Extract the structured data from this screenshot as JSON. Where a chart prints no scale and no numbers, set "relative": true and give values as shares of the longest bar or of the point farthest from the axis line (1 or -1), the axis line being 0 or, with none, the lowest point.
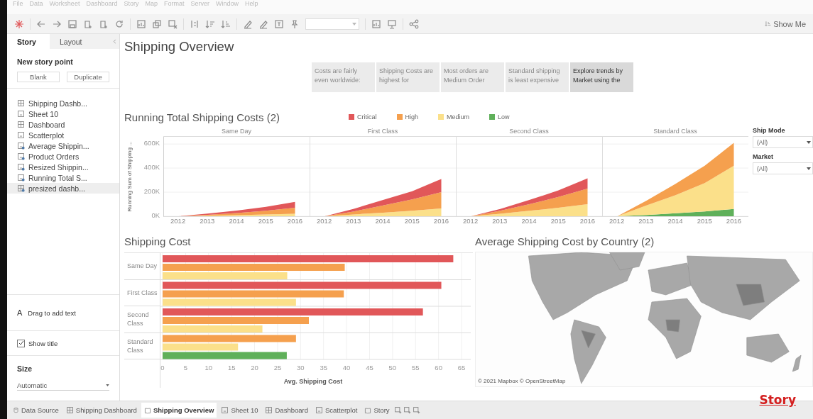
{
  "menu_bar": {
    "items": [
      "File",
      "Data",
      "Worksheet",
      "Dashboard",
      "Story",
      "Map",
      "Format",
      "Server",
      "Window",
      "Help"
    ]
  },
  "toolbar": {
    "show_me": "Show Me"
  },
  "side_panel": {
    "tabs": [
      {
        "label": "Story",
        "selected": true
      },
      {
        "label": "Layout",
        "selected": false
      }
    ],
    "new_story_point": {
      "title": "New story point",
      "buttons": [
        "Blank",
        "Duplicate"
      ]
    },
    "sheets": [
      {
        "label": "Shipping Dashb...",
        "kind": "dashboard",
        "selected": false
      },
      {
        "label": "Sheet 10",
        "kind": "sheet",
        "selected": false
      },
      {
        "label": "Dashboard",
        "kind": "dashboard",
        "selected": false
      },
      {
        "label": "Scatterplot",
        "kind": "sheet",
        "selected": false
      },
      {
        "label": "Average Shippin...",
        "kind": "linked-sheet",
        "selected": false
      },
      {
        "label": "Product Orders",
        "kind": "linked-sheet",
        "selected": false
      },
      {
        "label": "Resized Shippin...",
        "kind": "linked-sheet",
        "selected": false
      },
      {
        "label": "Running Total S...",
        "kind": "linked-sheet",
        "selected": false
      },
      {
        "label": "presized dashb...",
        "kind": "linked-dashboard",
        "selected": true
      }
    ],
    "drag_text": {
      "glyph": "A",
      "label": "Drag to add text"
    },
    "show_title": {
      "label": "Show title",
      "checked": true
    },
    "size": {
      "title": "Size",
      "value": "Automatic"
    }
  },
  "story": {
    "title": "Shipping Overview",
    "points": [
      {
        "caption": "Costs are fairly even worldwide:",
        "selected": false
      },
      {
        "caption": "Shipping Costs are highest for",
        "selected": false
      },
      {
        "caption": "Most orders are Medium Order",
        "selected": false
      },
      {
        "caption": "Standard shipping is least expensive",
        "selected": false
      },
      {
        "caption": "Explore trends by Market using the",
        "selected": true
      }
    ]
  },
  "running_total": {
    "title": "Running Total Shipping Costs (2)",
    "ylabel": "Running Sum of Shipping ...",
    "legend": [
      {
        "label": "Critical",
        "color": "#e15759"
      },
      {
        "label": "High",
        "color": "#f5a04e"
      },
      {
        "label": "Medium",
        "color": "#fbe08a"
      },
      {
        "label": "Low",
        "color": "#5fb05a"
      }
    ],
    "panels": [
      {
        "chart_data": {
          "type": "area",
          "stacked": true,
          "grid": true,
          "title": "Same Day",
          "categories": [
            "2012",
            "2013",
            "2014",
            "2015",
            "2016"
          ],
          "ylim": [
            0,
            660000
          ],
          "yticks": [
            {
              "value": 600000,
              "label": "600K"
            },
            {
              "value": 400000,
              "label": "400K"
            },
            {
              "value": 200000,
              "label": "200K"
            },
            {
              "value": 0,
              "label": "0K"
            }
          ],
          "series": [
            {
              "color": "#fbe08a",
              "values": [
                0,
                4000,
                9000,
                14000,
                20000
              ]
            },
            {
              "color": "#f5a04e",
              "values": [
                0,
                8000,
                18000,
                32000,
                50000
              ]
            },
            {
              "color": "#e15759",
              "values": [
                0,
                10000,
                20000,
                32000,
                50000
              ]
            }
          ]
        }
      },
      {
        "chart_data": {
          "type": "area",
          "stacked": true,
          "grid": true,
          "title": "First Class",
          "categories": [
            "2012",
            "2013",
            "2014",
            "2015",
            "2016"
          ],
          "relative": true,
          "ylim": [
            0,
            660000
          ],
          "series": [
            {
              "color": "#fbe08a",
              "values": [
                0,
                15000,
                30000,
                45000,
                65000
              ]
            },
            {
              "color": "#f5a04e",
              "values": [
                0,
                25000,
                60000,
                95000,
                135000
              ]
            },
            {
              "color": "#e15759",
              "values": [
                0,
                22000,
                45000,
                68000,
                110000
              ]
            }
          ]
        }
      },
      {
        "chart_data": {
          "type": "area",
          "stacked": true,
          "grid": true,
          "title": "Second Class",
          "categories": [
            "2012",
            "2013",
            "2014",
            "2015",
            "2016"
          ],
          "relative": true,
          "ylim": [
            0,
            660000
          ],
          "series": [
            {
              "color": "#fbe08a",
              "values": [
                0,
                20000,
                45000,
                70000,
                100000
              ]
            },
            {
              "color": "#f5a04e",
              "values": [
                0,
                25000,
                55000,
                90000,
                130000
              ]
            },
            {
              "color": "#e15759",
              "values": [
                0,
                15000,
                35000,
                55000,
                85000
              ]
            }
          ]
        }
      },
      {
        "chart_data": {
          "type": "area",
          "stacked": true,
          "grid": true,
          "title": "Standard Class",
          "categories": [
            "2012",
            "2013",
            "2014",
            "2015",
            "2016"
          ],
          "relative": true,
          "ylim": [
            0,
            660000
          ],
          "series": [
            {
              "color": "#5fb05a",
              "values": [
                0,
                10000,
                25000,
                40000,
                60000
              ]
            },
            {
              "color": "#fbe08a",
              "values": [
                0,
                80000,
                150000,
                235000,
                360000
              ]
            },
            {
              "color": "#f5a04e",
              "values": [
                0,
                40000,
                95000,
                145000,
                190000
              ]
            }
          ]
        }
      }
    ]
  },
  "filters": [
    {
      "title": "Ship Mode",
      "value": "(All)"
    },
    {
      "title": "Market",
      "value": "(All)"
    }
  ],
  "shipping_cost": {
    "title": "Shipping Cost",
    "chart_data": {
      "type": "bar",
      "orientation": "horizontal",
      "grid": true,
      "categories": [
        "Same Day",
        "First Class",
        "Second Class",
        "Standard Class"
      ],
      "xlabel": "Avg. Shipping Cost",
      "xlim": [
        0,
        67
      ],
      "xticks": [
        0,
        5,
        10,
        15,
        20,
        25,
        30,
        35,
        40,
        45,
        50,
        55,
        60,
        65
      ],
      "series": [
        {
          "color": "#e15759",
          "values": [
            63.2,
            60.6,
            56.6,
            null
          ]
        },
        {
          "color": "#f5a04e",
          "values": [
            39.6,
            39.4,
            31.8,
            29
          ]
        },
        {
          "color": "#fbe08a",
          "values": [
            27.1,
            29,
            21.7,
            16.4
          ]
        },
        {
          "color": "#5fb05a",
          "values": [
            null,
            null,
            null,
            27
          ]
        }
      ]
    }
  },
  "map": {
    "title": "Average Shipping Cost by Country (2)",
    "kind": "picture",
    "attribution": "© 2021 Mapbox © OpenStreetMap"
  },
  "sheet_tabs": [
    {
      "label": "Data Source",
      "kind": "datasource",
      "selected": false
    },
    {
      "label": "Shipping Dashboard",
      "kind": "dashboard",
      "selected": false
    },
    {
      "label": "Shipping Overview",
      "kind": "story",
      "selected": true
    },
    {
      "label": "Sheet 10",
      "kind": "sheet",
      "selected": false
    },
    {
      "label": "Dashboard",
      "kind": "dashboard",
      "selected": false
    },
    {
      "label": "Scatterplot",
      "kind": "sheet",
      "selected": false
    },
    {
      "label": "Story",
      "kind": "story",
      "selected": false
    }
  ],
  "overlay_label": "Story"
}
